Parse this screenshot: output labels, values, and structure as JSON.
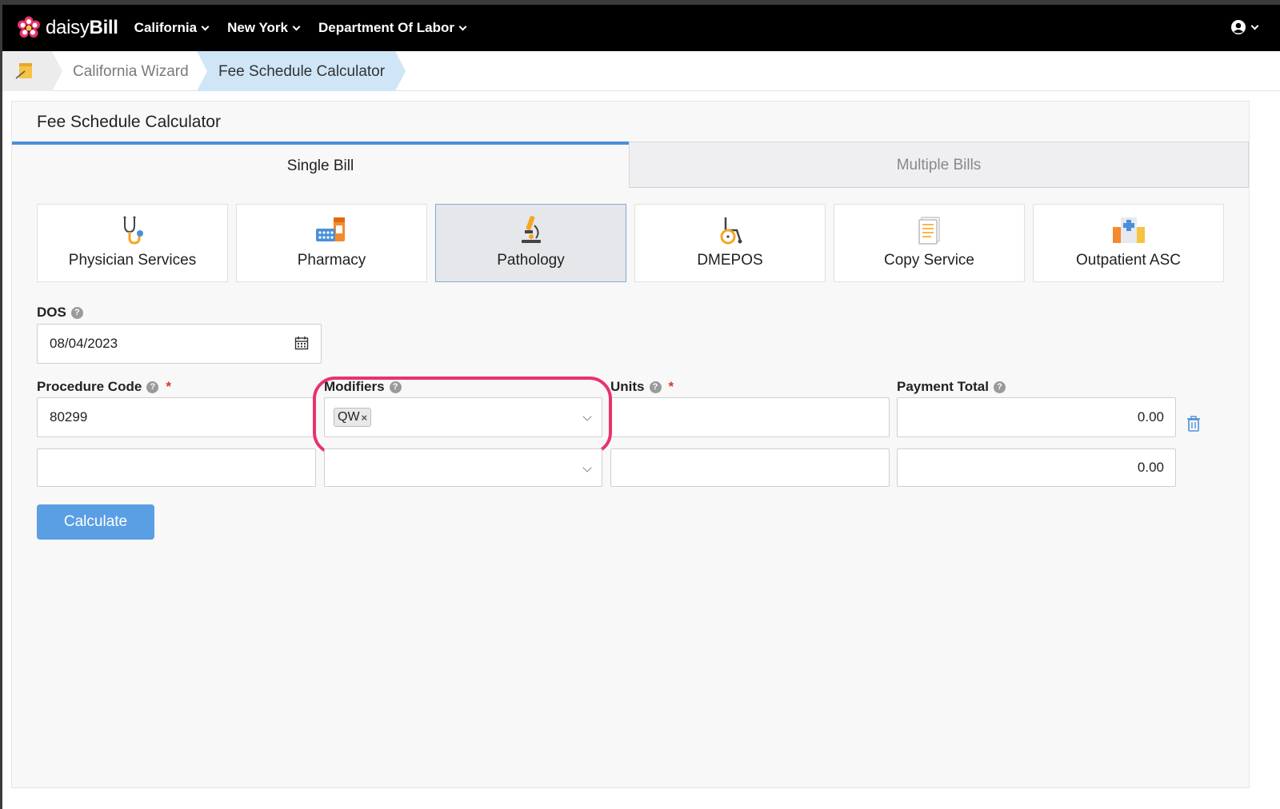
{
  "brand": {
    "name_light": "daisy",
    "name_bold": "Bill",
    "flower_color": "#e8336b"
  },
  "nav": {
    "items": [
      {
        "label": "California"
      },
      {
        "label": "New York"
      },
      {
        "label": "Department Of Labor"
      }
    ],
    "user_icon": "user-circle-icon"
  },
  "breadcrumb": {
    "home_icon": "notepad-icon",
    "items": [
      {
        "label": "California Wizard"
      },
      {
        "label": "Fee Schedule Calculator"
      }
    ]
  },
  "panel": {
    "title": "Fee Schedule Calculator"
  },
  "tabs": [
    {
      "label": "Single Bill",
      "active": true
    },
    {
      "label": "Multiple Bills",
      "active": false
    }
  ],
  "services": [
    {
      "label": "Physician Services",
      "icon": "stethoscope-icon",
      "active": false
    },
    {
      "label": "Pharmacy",
      "icon": "pills-icon",
      "active": false
    },
    {
      "label": "Pathology",
      "icon": "microscope-icon",
      "active": true
    },
    {
      "label": "DMEPOS",
      "icon": "wheelchair-icon",
      "active": false
    },
    {
      "label": "Copy Service",
      "icon": "document-copy-icon",
      "active": false
    },
    {
      "label": "Outpatient ASC",
      "icon": "hospital-icon",
      "active": false
    }
  ],
  "form": {
    "dos_label": "DOS",
    "dos_value": "08/04/2023",
    "procedure_code_label": "Procedure Code",
    "modifiers_label": "Modifiers",
    "units_label": "Units",
    "payment_total_label": "Payment Total",
    "required_mark": "*",
    "help_mark": "?",
    "rows": [
      {
        "procedure_code": "80299",
        "modifiers": [
          "QW"
        ],
        "units": "",
        "payment_total": "0.00"
      },
      {
        "procedure_code": "",
        "modifiers": [],
        "units": "",
        "payment_total": "0.00"
      }
    ],
    "tag_remove": "×",
    "calculate_label": "Calculate"
  },
  "colors": {
    "accent": "#4a90d9",
    "highlight": "#e8336b",
    "button": "#5a9ee3"
  }
}
